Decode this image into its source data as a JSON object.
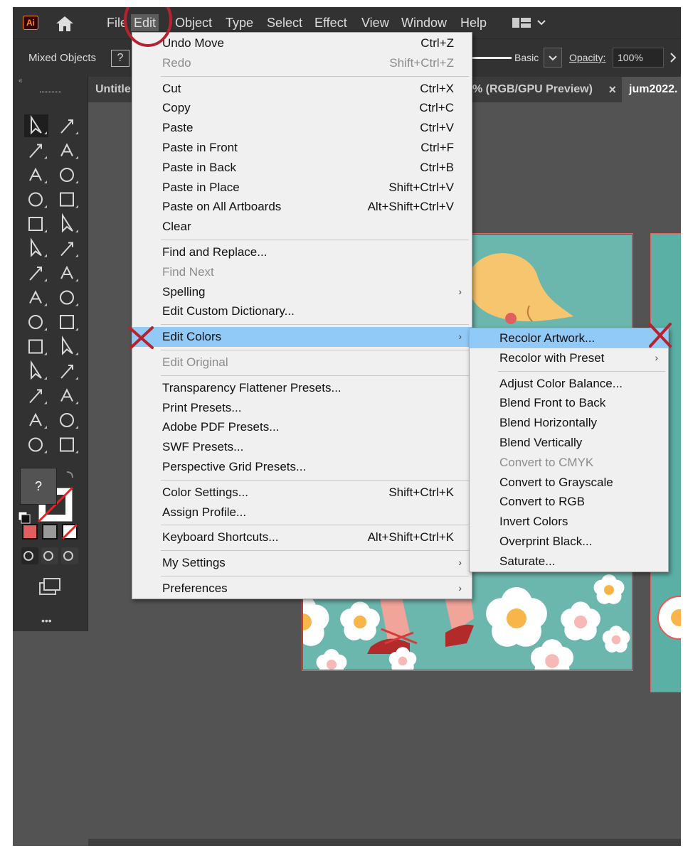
{
  "app": {
    "logo": "Ai"
  },
  "menubar": {
    "items": [
      "File",
      "Edit",
      "Object",
      "Type",
      "Select",
      "Effect",
      "View",
      "Window",
      "Help"
    ],
    "active": "Edit"
  },
  "control_bar": {
    "selection_label": "Mixed Objects",
    "question": "?",
    "stroke_style": "Basic",
    "opacity_label": "Opacity:",
    "opacity_value": "100%"
  },
  "tabs": [
    {
      "label": "Untitle"
    },
    {
      "label": "% (RGB/GPU Preview)"
    },
    {
      "label": "jum2022."
    }
  ],
  "tab_close": "×",
  "tools": {
    "fill_question": "?",
    "more": "•••"
  },
  "edit_menu": {
    "groups": [
      [
        {
          "label": "Undo Move",
          "shortcut": "Ctrl+Z",
          "disabled": false,
          "submenu": false
        },
        {
          "label": "Redo",
          "shortcut": "Shift+Ctrl+Z",
          "disabled": true,
          "submenu": false
        }
      ],
      [
        {
          "label": "Cut",
          "shortcut": "Ctrl+X",
          "disabled": false,
          "submenu": false
        },
        {
          "label": "Copy",
          "shortcut": "Ctrl+C",
          "disabled": false,
          "submenu": false
        },
        {
          "label": "Paste",
          "shortcut": "Ctrl+V",
          "disabled": false,
          "submenu": false
        },
        {
          "label": "Paste in Front",
          "shortcut": "Ctrl+F",
          "disabled": false,
          "submenu": false
        },
        {
          "label": "Paste in Back",
          "shortcut": "Ctrl+B",
          "disabled": false,
          "submenu": false
        },
        {
          "label": "Paste in Place",
          "shortcut": "Shift+Ctrl+V",
          "disabled": false,
          "submenu": false
        },
        {
          "label": "Paste on All Artboards",
          "shortcut": "Alt+Shift+Ctrl+V",
          "disabled": false,
          "submenu": false
        },
        {
          "label": "Clear",
          "shortcut": "",
          "disabled": false,
          "submenu": false
        }
      ],
      [
        {
          "label": "Find and Replace...",
          "shortcut": "",
          "disabled": false,
          "submenu": false
        },
        {
          "label": "Find Next",
          "shortcut": "",
          "disabled": true,
          "submenu": false
        },
        {
          "label": "Spelling",
          "shortcut": "",
          "disabled": false,
          "submenu": true
        },
        {
          "label": "Edit Custom Dictionary...",
          "shortcut": "",
          "disabled": false,
          "submenu": false
        }
      ],
      [
        {
          "label": "Edit Colors",
          "shortcut": "",
          "disabled": false,
          "submenu": true,
          "highlighted": true
        }
      ],
      [
        {
          "label": "Edit Original",
          "shortcut": "",
          "disabled": true,
          "submenu": false
        }
      ],
      [
        {
          "label": "Transparency Flattener Presets...",
          "shortcut": "",
          "disabled": false,
          "submenu": false
        },
        {
          "label": "Print Presets...",
          "shortcut": "",
          "disabled": false,
          "submenu": false
        },
        {
          "label": "Adobe PDF Presets...",
          "shortcut": "",
          "disabled": false,
          "submenu": false
        },
        {
          "label": "SWF Presets...",
          "shortcut": "",
          "disabled": false,
          "submenu": false
        },
        {
          "label": "Perspective Grid Presets...",
          "shortcut": "",
          "disabled": false,
          "submenu": false
        }
      ],
      [
        {
          "label": "Color Settings...",
          "shortcut": "Shift+Ctrl+K",
          "disabled": false,
          "submenu": false
        },
        {
          "label": "Assign Profile...",
          "shortcut": "",
          "disabled": false,
          "submenu": false
        }
      ],
      [
        {
          "label": "Keyboard Shortcuts...",
          "shortcut": "Alt+Shift+Ctrl+K",
          "disabled": false,
          "submenu": false
        }
      ],
      [
        {
          "label": "My Settings",
          "shortcut": "",
          "disabled": false,
          "submenu": true
        }
      ],
      [
        {
          "label": "Preferences",
          "shortcut": "",
          "disabled": false,
          "submenu": true
        }
      ]
    ]
  },
  "edit_colors_submenu": {
    "groups": [
      [
        {
          "label": "Recolor Artwork...",
          "disabled": false,
          "submenu": false,
          "highlighted": true
        },
        {
          "label": "Recolor with Preset",
          "disabled": false,
          "submenu": true
        }
      ],
      [
        {
          "label": "Adjust Color Balance...",
          "disabled": false,
          "submenu": false
        },
        {
          "label": "Blend Front to Back",
          "disabled": false,
          "submenu": false
        },
        {
          "label": "Blend Horizontally",
          "disabled": false,
          "submenu": false
        },
        {
          "label": "Blend Vertically",
          "disabled": false,
          "submenu": false
        },
        {
          "label": "Convert to CMYK",
          "disabled": true,
          "submenu": false
        },
        {
          "label": "Convert to Grayscale",
          "disabled": false,
          "submenu": false
        },
        {
          "label": "Convert to RGB",
          "disabled": false,
          "submenu": false
        },
        {
          "label": "Invert Colors",
          "disabled": false,
          "submenu": false
        },
        {
          "label": "Overprint Black...",
          "disabled": false,
          "submenu": false
        },
        {
          "label": "Saturate...",
          "disabled": false,
          "submenu": false
        }
      ]
    ]
  },
  "submenu_arrow": "›",
  "colors": {
    "annotation": "#b5232f",
    "highlight": "#91c9f7",
    "artboard": "#6cb7ad"
  }
}
